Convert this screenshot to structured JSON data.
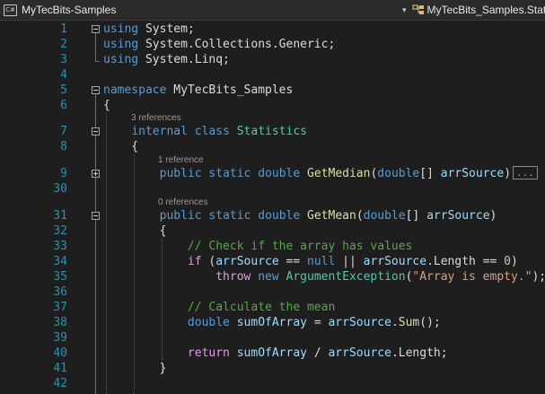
{
  "navbar": {
    "project_icon": "csharp-project-icon",
    "project_name": "MyTecBits-Samples",
    "class_icon": "class-icon",
    "class_name": "MyTecBits_Samples.Stati"
  },
  "codelens": {
    "statistics_refs": "3 references",
    "getmedian_refs": "1 reference",
    "getmean_refs": "0 references"
  },
  "ellipsis": "...",
  "line_numbers": [
    "1",
    "2",
    "3",
    "4",
    "5",
    "6",
    "7",
    "8",
    "9",
    "30",
    "31",
    "32",
    "33",
    "34",
    "35",
    "36",
    "37",
    "38",
    "39",
    "40",
    "41",
    "42"
  ],
  "code": {
    "l1": [
      {
        "t": "k",
        "v": "using"
      },
      {
        "t": "pl",
        "v": " System;"
      }
    ],
    "l2": [
      {
        "t": "k",
        "v": "using"
      },
      {
        "t": "pl",
        "v": " System.Collections.Generic;"
      }
    ],
    "l3": [
      {
        "t": "k",
        "v": "using"
      },
      {
        "t": "pl",
        "v": " System.Linq;"
      }
    ],
    "l5": [
      {
        "t": "k",
        "v": "namespace"
      },
      {
        "t": "pl",
        "v": " MyTecBits_Samples"
      }
    ],
    "l6": [
      {
        "t": "pl",
        "v": "{"
      }
    ],
    "l7": [
      {
        "t": "pl",
        "v": "    "
      },
      {
        "t": "k",
        "v": "internal"
      },
      {
        "t": "pl",
        "v": " "
      },
      {
        "t": "k",
        "v": "class"
      },
      {
        "t": "pl",
        "v": " "
      },
      {
        "t": "t",
        "v": "Statistics"
      }
    ],
    "l8": [
      {
        "t": "pl",
        "v": "    {"
      }
    ],
    "l9": [
      {
        "t": "pl",
        "v": "        "
      },
      {
        "t": "k",
        "v": "public"
      },
      {
        "t": "pl",
        "v": " "
      },
      {
        "t": "k",
        "v": "static"
      },
      {
        "t": "pl",
        "v": " "
      },
      {
        "t": "k",
        "v": "double"
      },
      {
        "t": "pl",
        "v": " "
      },
      {
        "t": "m",
        "v": "GetMedian"
      },
      {
        "t": "pl",
        "v": "("
      },
      {
        "t": "k",
        "v": "double"
      },
      {
        "t": "pl",
        "v": "[] "
      },
      {
        "t": "p",
        "v": "arrSource"
      },
      {
        "t": "pl",
        "v": ")"
      }
    ],
    "l31": [
      {
        "t": "pl",
        "v": "        "
      },
      {
        "t": "k",
        "v": "public"
      },
      {
        "t": "pl",
        "v": " "
      },
      {
        "t": "k",
        "v": "static"
      },
      {
        "t": "pl",
        "v": " "
      },
      {
        "t": "k",
        "v": "double"
      },
      {
        "t": "pl",
        "v": " "
      },
      {
        "t": "m",
        "v": "GetMean"
      },
      {
        "t": "pl",
        "v": "("
      },
      {
        "t": "k",
        "v": "double"
      },
      {
        "t": "pl",
        "v": "[] "
      },
      {
        "t": "p",
        "v": "arrSource"
      },
      {
        "t": "pl",
        "v": ")"
      }
    ],
    "l32": [
      {
        "t": "pl",
        "v": "        {"
      }
    ],
    "l33": [
      {
        "t": "pl",
        "v": "            "
      },
      {
        "t": "c",
        "v": "// Check if the array has values"
      }
    ],
    "l34": [
      {
        "t": "pl",
        "v": "            "
      },
      {
        "t": "ctl",
        "v": "if"
      },
      {
        "t": "pl",
        "v": " ("
      },
      {
        "t": "p",
        "v": "arrSource"
      },
      {
        "t": "pl",
        "v": " == "
      },
      {
        "t": "k",
        "v": "null"
      },
      {
        "t": "pl",
        "v": " || "
      },
      {
        "t": "p",
        "v": "arrSource"
      },
      {
        "t": "pl",
        "v": ".Length == "
      },
      {
        "t": "n",
        "v": "0"
      },
      {
        "t": "pl",
        "v": ")"
      }
    ],
    "l35": [
      {
        "t": "pl",
        "v": "                "
      },
      {
        "t": "ctl",
        "v": "throw"
      },
      {
        "t": "pl",
        "v": " "
      },
      {
        "t": "k",
        "v": "new"
      },
      {
        "t": "pl",
        "v": " "
      },
      {
        "t": "t",
        "v": "ArgumentException"
      },
      {
        "t": "pl",
        "v": "("
      },
      {
        "t": "s",
        "v": "\"Array is empty.\""
      },
      {
        "t": "pl",
        "v": ");"
      }
    ],
    "l37": [
      {
        "t": "pl",
        "v": "            "
      },
      {
        "t": "c",
        "v": "// Calculate the mean"
      }
    ],
    "l38": [
      {
        "t": "pl",
        "v": "            "
      },
      {
        "t": "k",
        "v": "double"
      },
      {
        "t": "pl",
        "v": " "
      },
      {
        "t": "p",
        "v": "sumOfArray"
      },
      {
        "t": "pl",
        "v": " = "
      },
      {
        "t": "p",
        "v": "arrSource"
      },
      {
        "t": "pl",
        "v": "."
      },
      {
        "t": "m",
        "v": "Sum"
      },
      {
        "t": "pl",
        "v": "();"
      }
    ],
    "l40": [
      {
        "t": "pl",
        "v": "            "
      },
      {
        "t": "ctl",
        "v": "return"
      },
      {
        "t": "pl",
        "v": " "
      },
      {
        "t": "p",
        "v": "sumOfArray"
      },
      {
        "t": "pl",
        "v": " / "
      },
      {
        "t": "p",
        "v": "arrSource"
      },
      {
        "t": "pl",
        "v": ".Length;"
      }
    ],
    "l41": [
      {
        "t": "pl",
        "v": "        }"
      }
    ]
  },
  "colors": {
    "background": "#1e1e1e",
    "line_number": "#2b91af",
    "keyword": "#569cd6",
    "control_keyword": "#d8a0df",
    "type": "#4ec9b0",
    "method": "#dcdcaa",
    "parameter": "#9cdcfe",
    "string": "#d69d85",
    "comment": "#57a64a",
    "number": "#b5cea8"
  }
}
